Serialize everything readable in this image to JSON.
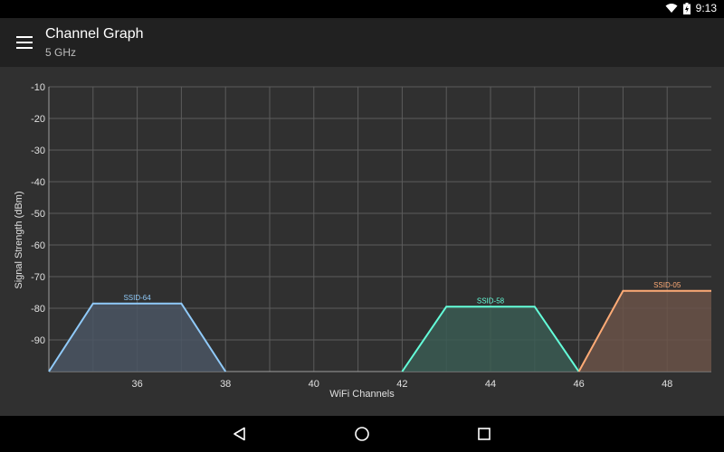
{
  "status": {
    "time": "9:13"
  },
  "app_bar": {
    "title": "Channel Graph",
    "subtitle": "5 GHz"
  },
  "chart_data": {
    "type": "area",
    "xlabel": "WiFi Channels",
    "ylabel": "Signal Strength (dBm)",
    "x_ticks": [
      36,
      38,
      40,
      42,
      44,
      46,
      48
    ],
    "y_ticks": [
      -10,
      -20,
      -30,
      -40,
      -50,
      -60,
      -70,
      -80,
      -90
    ],
    "xlim": [
      34,
      49
    ],
    "ylim": [
      -100,
      -10
    ],
    "grid": true,
    "series": [
      {
        "name": "SSID-64",
        "color": "#90caf9",
        "fill": "#4a5563",
        "points": [
          [
            34,
            -100
          ],
          [
            35,
            -78.5
          ],
          [
            37,
            -78.5
          ],
          [
            38,
            -100
          ]
        ]
      },
      {
        "name": "SSID-58",
        "color": "#64ffda",
        "fill": "#3a5a52",
        "points": [
          [
            42,
            -100
          ],
          [
            43,
            -79.5
          ],
          [
            45,
            -79.5
          ],
          [
            46,
            -100
          ]
        ]
      },
      {
        "name": "SSID-05",
        "color": "#ffab76",
        "fill": "#6a5248",
        "points": [
          [
            46,
            -100
          ],
          [
            47,
            -74.5
          ],
          [
            49,
            -74.5
          ]
        ]
      }
    ]
  }
}
